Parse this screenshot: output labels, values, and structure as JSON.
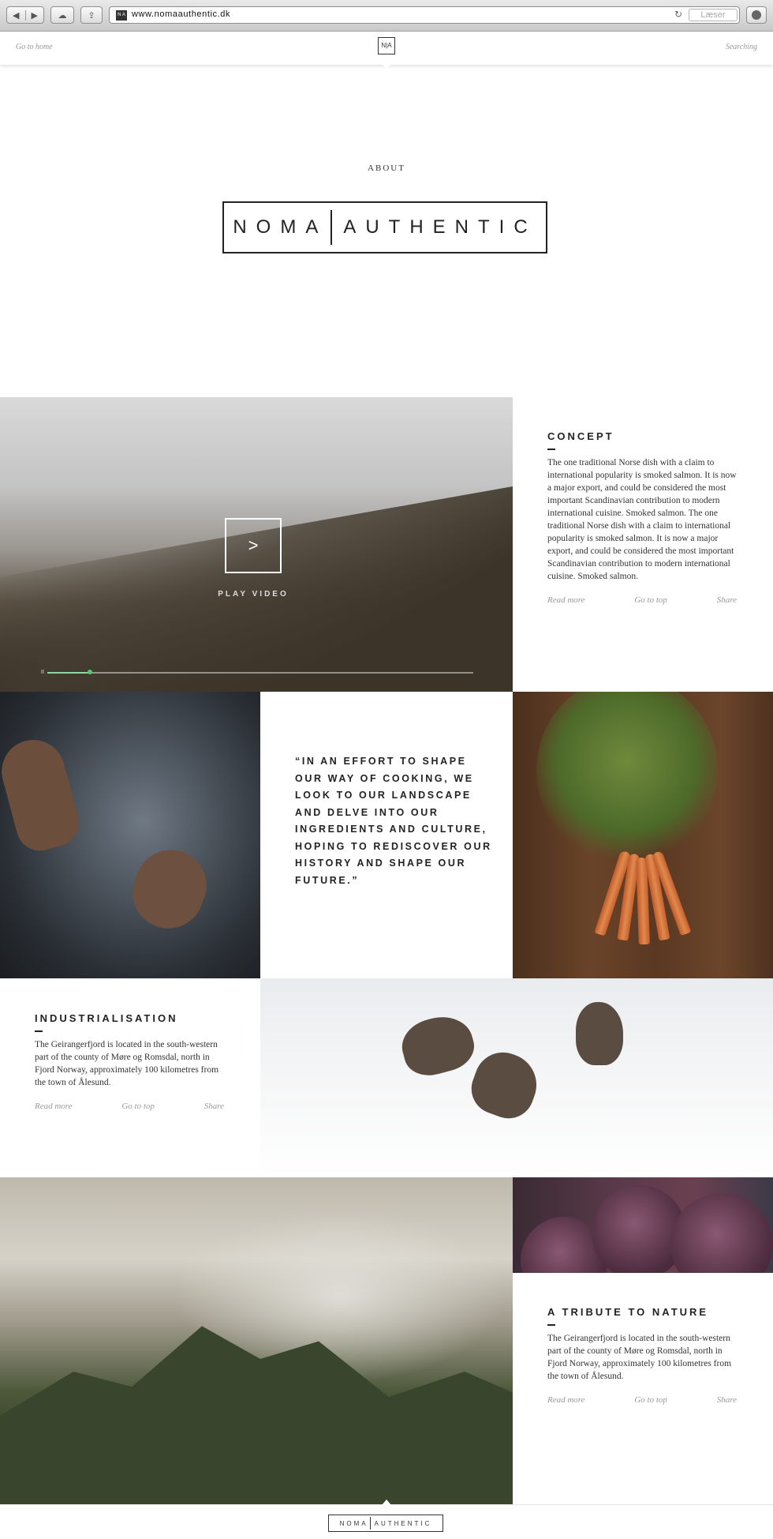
{
  "browser": {
    "url": "www.nomaauthentic.dk",
    "reader_label": "Læser",
    "back_glyph": "◀",
    "forward_glyph": "▶",
    "reload_glyph": "↻",
    "favicon_text": "N A"
  },
  "topbar": {
    "home_link": "Go to home",
    "search_link": "Searching",
    "mini_logo": "N|A"
  },
  "hero": {
    "about": "ABOUT",
    "logo_left": "NOMA",
    "logo_right": "AUTHENTIC"
  },
  "video": {
    "play_glyph": ">",
    "play_label": "PLAY VIDEO",
    "pause_glyph": "II",
    "progress_fraction": 0.1
  },
  "concept": {
    "title": "CONCEPT",
    "body": "The one traditional Norse dish with a claim to international popularity is smoked salmon. It is now a major export, and could be considered the most important Scandinavian contribution to modern international cuisine. Smoked salmon. The one traditional Norse dish with a claim to international popularity is smoked salmon. It is now a major export, and could be considered the most important Scandinavian contribution to modern international cuisine. Smoked salmon.",
    "read_more": "Read more",
    "go_top": "Go to top",
    "share": "Share"
  },
  "quote": {
    "text": "“IN AN EFFORT TO SHAPE OUR WAY OF COOKING, WE LOOK TO OUR LANDSCAPE AND DELVE INTO OUR INGREDIENTS AND CULTURE, HOPING TO REDISCOVER OUR HISTORY AND SHAPE OUR FUTURE.”"
  },
  "industrialisation": {
    "title": "INDUSTRIALISATION",
    "body": "The Geirangerfjord is located in the south-western part of the county of Møre og Romsdal, north in Fjord Norway, approximately 100 kilometres from the town of Ålesund.",
    "read_more": "Read more",
    "go_top": "Go to top",
    "share": "Share"
  },
  "tribute": {
    "title": "A TRIBUTE TO NATURE",
    "body": "The Geirangerfjord is located in the south-western part of the county of Møre og Romsdal, north in Fjord Norway, approximately 100 kilometres from the town of Ålesund.",
    "read_more": "Read more",
    "go_top": "Go to top",
    "share": "Share"
  },
  "footer": {
    "logo_left": "NOMA",
    "logo_right": "AUTHENTIC"
  },
  "colors": {
    "text": "#222222",
    "muted_link": "#999999",
    "progress": "#5cc66f"
  }
}
